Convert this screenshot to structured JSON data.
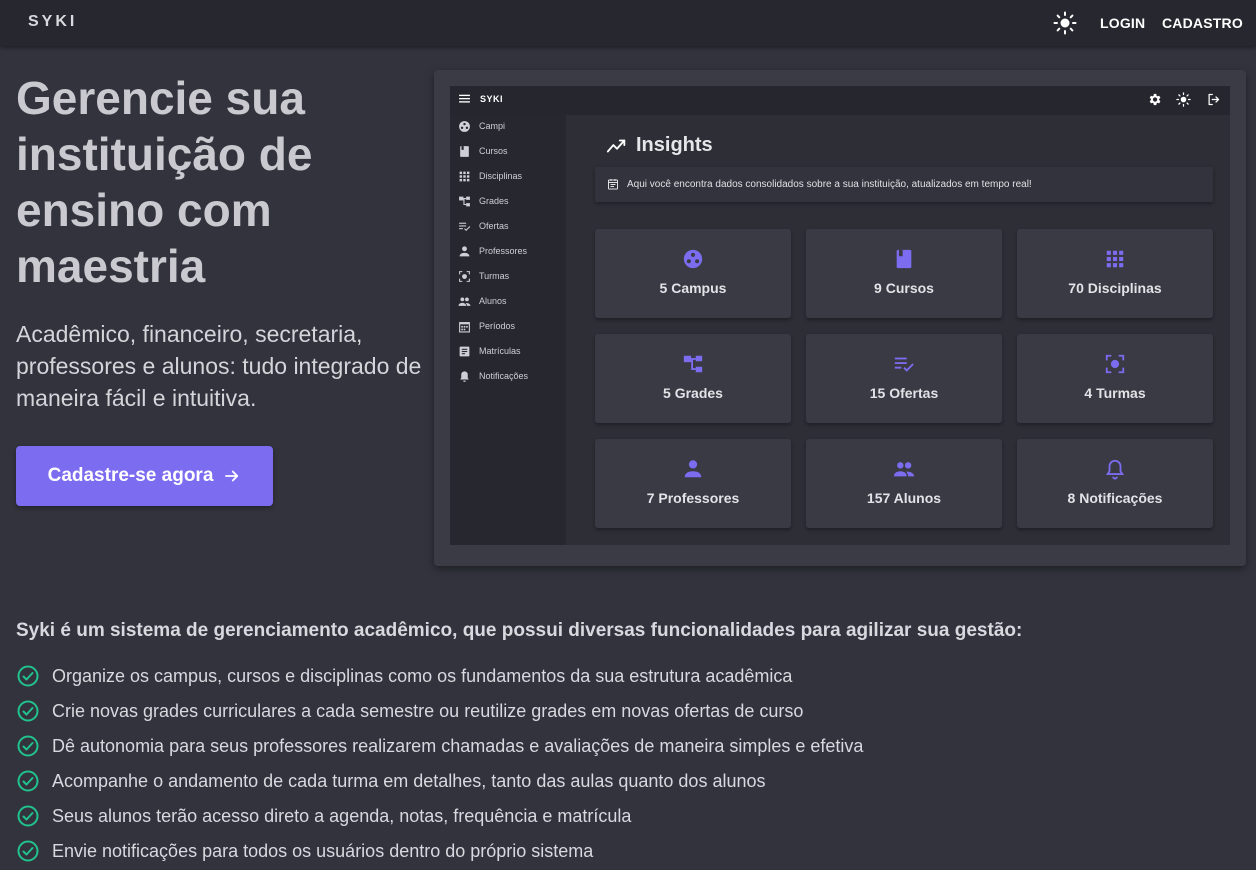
{
  "header": {
    "brand": "SYKI",
    "login": "LOGIN",
    "signup": "CADASTRO",
    "theme_icon": "sun-icon"
  },
  "hero": {
    "title": "Gerencie sua instituição de ensino com maestria",
    "subtitle": "Acadêmico, financeiro, secretaria, professores e alunos: tudo integrado de maneira fácil e intuitiva.",
    "cta": "Cadastre-se agora"
  },
  "preview": {
    "brand": "SYKI",
    "sidebar": [
      {
        "label": "Campi",
        "icon": "campus-icon"
      },
      {
        "label": "Cursos",
        "icon": "book-icon"
      },
      {
        "label": "Disciplinas",
        "icon": "grid-icon"
      },
      {
        "label": "Grades",
        "icon": "tree-icon"
      },
      {
        "label": "Ofertas",
        "icon": "checklist-icon"
      },
      {
        "label": "Professores",
        "icon": "person-icon"
      },
      {
        "label": "Turmas",
        "icon": "focus-icon"
      },
      {
        "label": "Alunos",
        "icon": "group-icon"
      },
      {
        "label": "Períodos",
        "icon": "calendar-icon"
      },
      {
        "label": "Matrículas",
        "icon": "document-icon"
      },
      {
        "label": "Notificações",
        "icon": "bell-icon"
      }
    ],
    "insights_title": "Insights",
    "info_text": "Aqui você encontra dados consolidados sobre a sua instituição, atualizados em tempo real!",
    "cards": [
      {
        "label": "5 Campus",
        "icon": "campus-icon"
      },
      {
        "label": "9 Cursos",
        "icon": "book-icon"
      },
      {
        "label": "70 Disciplinas",
        "icon": "grid-icon"
      },
      {
        "label": "5 Grades",
        "icon": "tree-icon"
      },
      {
        "label": "15 Ofertas",
        "icon": "checklist-icon"
      },
      {
        "label": "4 Turmas",
        "icon": "focus-icon"
      },
      {
        "label": "7 Professores",
        "icon": "person-icon"
      },
      {
        "label": "157 Alunos",
        "icon": "group-icon"
      },
      {
        "label": "8 Notificações",
        "icon": "bell-icon"
      }
    ]
  },
  "features": {
    "intro": "Syki é um sistema de gerenciamento acadêmico, que possui diversas funcionalidades para agilizar sua gestão:",
    "items": [
      "Organize os campus, cursos e disciplinas como os fundamentos da sua estrutura acadêmica",
      "Crie novas grades curriculares a cada semestre ou reutilize grades em novas ofertas de curso",
      "Dê autonomia para seus professores realizarem chamadas e avaliações de maneira simples e efetiva",
      "Acompanhe o andamento de cada turma em detalhes, tanto das aulas quanto dos alunos",
      "Seus alunos terão acesso direto a agenda, notas, frequência e matrícula",
      "Envie notificações para todos os usuários dentro do próprio sistema"
    ]
  },
  "colors": {
    "accent": "#7b6cf0",
    "check": "#21c28e"
  }
}
